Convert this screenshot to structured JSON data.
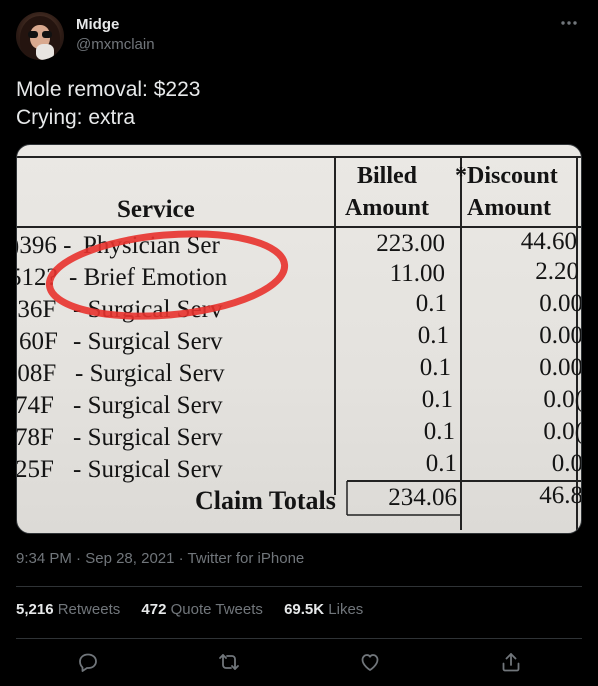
{
  "user": {
    "display_name": "Midge",
    "handle": "@mxmclain"
  },
  "tweet": {
    "lines": [
      "Mole removal: $223",
      "Crying: extra"
    ]
  },
  "receipt": {
    "headers": {
      "service": "Service",
      "billed_1": "Billed",
      "billed_2": "Amount",
      "discount_1": "*Discount",
      "discount_2": "Amount"
    },
    "rows": [
      {
        "code": ")396 -",
        "desc": "Physician Ser",
        "billed": "223.00",
        "discount": "44.60"
      },
      {
        "code": "512?",
        "desc": "- Brief Emotion",
        "billed": "11.00",
        "discount": "2.20"
      },
      {
        "code": ")36F",
        "desc": "- Surgical Serv",
        "billed": "0.1",
        "discount": "0.00"
      },
      {
        "code": "60F",
        "desc": "- Surgical Serv",
        "billed": "0.1",
        "discount": "0.00"
      },
      {
        "code": ")08F",
        "desc": "- Surgical Serv",
        "billed": "0.1",
        "discount": "0.00"
      },
      {
        "code": "74F",
        "desc": "- Surgical Serv",
        "billed": "0.1",
        "discount": "0.0("
      },
      {
        "code": "78F",
        "desc": "- Surgical Serv",
        "billed": "0.1",
        "discount": "0.0("
      },
      {
        "code": "25F",
        "desc": "- Surgical Serv",
        "billed": "0.1",
        "discount": "0.0"
      }
    ],
    "totals": {
      "label": "Claim Totals",
      "billed": "234.06",
      "discount": "46.8"
    },
    "annotation_color": "#e8322e"
  },
  "meta": {
    "time": "9:34 PM",
    "sep": " · ",
    "date": "Sep 28, 2021",
    "source": "Twitter for iPhone"
  },
  "stats": {
    "retweets": {
      "count": "5,216",
      "label": "Retweets"
    },
    "quotes": {
      "count": "472",
      "label": "Quote Tweets"
    },
    "likes": {
      "count": "69.5K",
      "label": "Likes"
    }
  },
  "actions": [
    "reply-icon",
    "retweet-icon",
    "like-icon",
    "share-icon"
  ],
  "colors": {
    "background": "#000000",
    "text": "#e7e9ea",
    "secondary": "#71767b",
    "border": "#2f3336"
  }
}
